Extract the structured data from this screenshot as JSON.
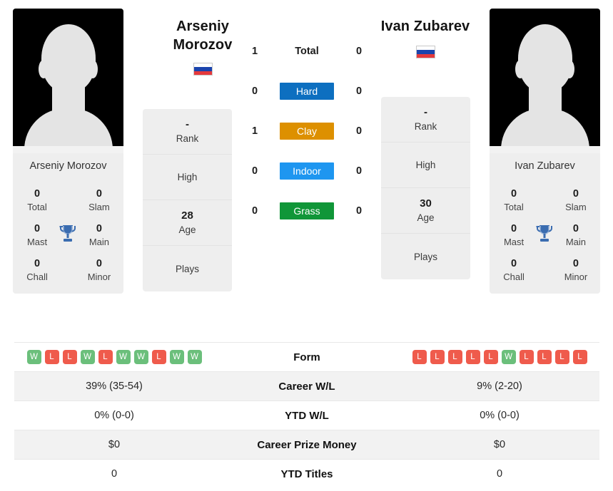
{
  "colors": {
    "hard": "#0d6fc0",
    "clay": "#dd9000",
    "indoor": "#1e96f0",
    "grass": "#109638",
    "win": "#6bbf7b",
    "loss": "#ef5b4c",
    "trophy": "#3a6cb0"
  },
  "players": {
    "left": {
      "name": "Arseniy Morozov",
      "name_line1": "Arseniy",
      "name_line2": "Morozov",
      "card_name": "Arseniy Morozov",
      "flag": "russia-flag",
      "titles": {
        "total_value": "0",
        "total_label": "Total",
        "slam_value": "0",
        "slam_label": "Slam",
        "mast_value": "0",
        "mast_label": "Mast",
        "main_value": "0",
        "main_label": "Main",
        "chall_value": "0",
        "chall_label": "Chall",
        "minor_value": "0",
        "minor_label": "Minor"
      },
      "info": [
        {
          "value": "-",
          "label": "Rank"
        },
        {
          "value": "",
          "label": "High"
        },
        {
          "value": "28",
          "label": "Age"
        },
        {
          "value": "",
          "label": "Plays"
        }
      ],
      "form": [
        "W",
        "L",
        "L",
        "W",
        "L",
        "W",
        "W",
        "L",
        "W",
        "W"
      ],
      "career_wl": "39% (35-54)",
      "ytd_wl": "0% (0-0)",
      "career_prize_money": "$0",
      "ytd_titles": "0"
    },
    "right": {
      "name": "Ivan Zubarev",
      "name_line1": "Ivan Zubarev",
      "card_name": "Ivan Zubarev",
      "flag": "russia-flag",
      "titles": {
        "total_value": "0",
        "total_label": "Total",
        "slam_value": "0",
        "slam_label": "Slam",
        "mast_value": "0",
        "mast_label": "Mast",
        "main_value": "0",
        "main_label": "Main",
        "chall_value": "0",
        "chall_label": "Chall",
        "minor_value": "0",
        "minor_label": "Minor"
      },
      "info": [
        {
          "value": "-",
          "label": "Rank"
        },
        {
          "value": "",
          "label": "High"
        },
        {
          "value": "30",
          "label": "Age"
        },
        {
          "value": "",
          "label": "Plays"
        }
      ],
      "form": [
        "L",
        "L",
        "L",
        "L",
        "L",
        "W",
        "L",
        "L",
        "L",
        "L"
      ],
      "career_wl": "9% (2-20)",
      "ytd_wl": "0% (0-0)",
      "career_prize_money": "$0",
      "ytd_titles": "0"
    }
  },
  "head_to_head": [
    {
      "label": "Total",
      "left": "1",
      "right": "0",
      "badge": false
    },
    {
      "label": "Hard",
      "left": "0",
      "right": "0",
      "badge": true,
      "color": "#0d6fc0"
    },
    {
      "label": "Clay",
      "left": "1",
      "right": "0",
      "badge": true,
      "color": "#dd9000"
    },
    {
      "label": "Indoor",
      "left": "0",
      "right": "0",
      "badge": true,
      "color": "#1e96f0"
    },
    {
      "label": "Grass",
      "left": "0",
      "right": "0",
      "badge": true,
      "color": "#109638"
    }
  ],
  "table_rows": [
    {
      "label": "Form",
      "type": "form"
    },
    {
      "label": "Career W/L",
      "type": "text",
      "left": "39% (35-54)",
      "right": "9% (2-20)"
    },
    {
      "label": "YTD W/L",
      "type": "text",
      "left": "0% (0-0)",
      "right": "0% (0-0)"
    },
    {
      "label": "Career Prize Money",
      "type": "text",
      "left": "$0",
      "right": "$0"
    },
    {
      "label": "YTD Titles",
      "type": "text",
      "left": "0",
      "right": "0"
    }
  ]
}
